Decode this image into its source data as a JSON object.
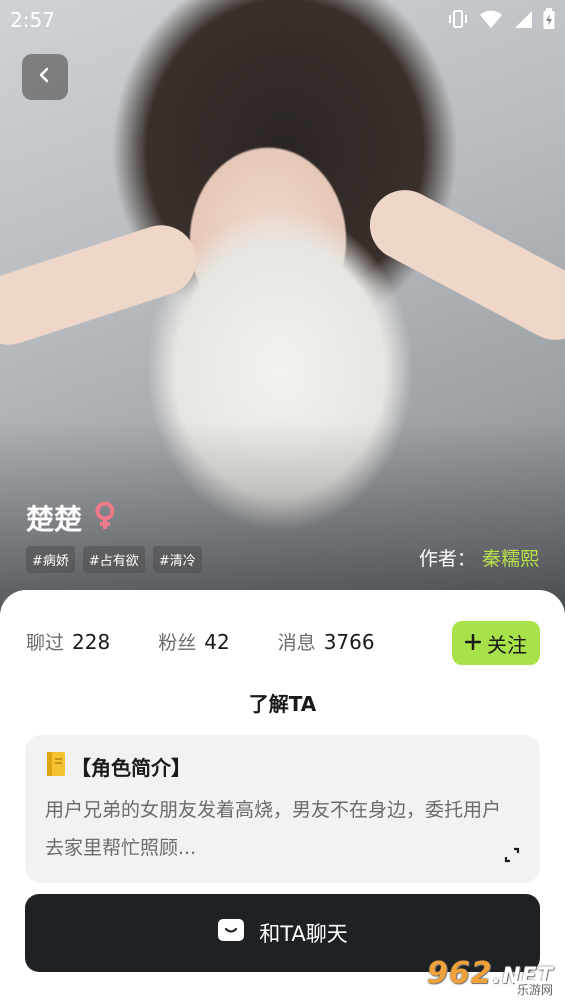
{
  "status_bar": {
    "time": "2:57"
  },
  "character": {
    "name": "楚楚",
    "tags": [
      "#病娇",
      "#占有欲",
      "#清冷"
    ],
    "author_label": "作者：",
    "author_name": "秦糯熙"
  },
  "stats": [
    {
      "label": "聊过",
      "value": "228"
    },
    {
      "label": "粉丝",
      "value": "42"
    },
    {
      "label": "消息",
      "value": "3766"
    }
  ],
  "follow_label": "关注",
  "section_title": "了解TA",
  "intro": {
    "title": "【角色简介】",
    "text": "用户兄弟的女朋友发着高烧，男友不在身边，委托用户去家里帮忙照顾..."
  },
  "chat_button_label": "和TA聊天",
  "watermark": {
    "logo_main": "962",
    "logo_suffix": ".NET",
    "sub": "乐游网"
  },
  "colors": {
    "accent": "#a8e24a",
    "author": "#b8e34a",
    "female_symbol": "#f07a8a",
    "chat_button": "#1f2225"
  }
}
